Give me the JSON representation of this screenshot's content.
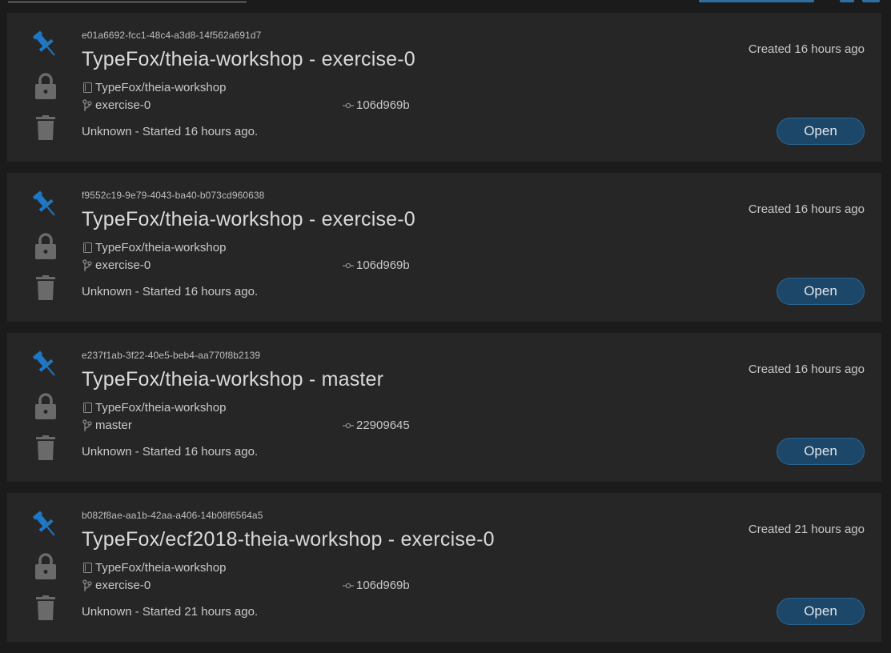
{
  "colors": {
    "background": "#1b1b1b",
    "card": "#262626",
    "pin": "#1e78c6",
    "icon_muted": "#6a6a6a",
    "open_button": "#1c4769"
  },
  "icons": {
    "pin": "pin-icon",
    "lock": "lock-icon",
    "trash": "trash-icon",
    "repo": "repo-icon",
    "branch": "branch-icon",
    "commit": "commit-icon"
  },
  "workspaces": [
    {
      "id": "e01a6692-fcc1-48c4-a3d8-14f562a691d7",
      "title": "TypeFox/theia-workshop - exercise-0",
      "repo": "TypeFox/theia-workshop",
      "branch": "exercise-0",
      "commit": "106d969b",
      "status": "Unknown - Started 16 hours ago.",
      "created": "Created 16 hours ago",
      "open_label": "Open"
    },
    {
      "id": "f9552c19-9e79-4043-ba40-b073cd960638",
      "title": "TypeFox/theia-workshop - exercise-0",
      "repo": "TypeFox/theia-workshop",
      "branch": "exercise-0",
      "commit": "106d969b",
      "status": "Unknown - Started 16 hours ago.",
      "created": "Created 16 hours ago",
      "open_label": "Open"
    },
    {
      "id": "e237f1ab-3f22-40e5-beb4-aa770f8b2139",
      "title": "TypeFox/theia-workshop - master",
      "repo": "TypeFox/theia-workshop",
      "branch": "master",
      "commit": "22909645",
      "status": "Unknown - Started 16 hours ago.",
      "created": "Created 16 hours ago",
      "open_label": "Open"
    },
    {
      "id": "b082f8ae-aa1b-42aa-a406-14b08f6564a5",
      "title": "TypeFox/ecf2018-theia-workshop - exercise-0",
      "repo": "TypeFox/theia-workshop",
      "branch": "exercise-0",
      "commit": "106d969b",
      "status": "Unknown - Started 21 hours ago.",
      "created": "Created 21 hours ago",
      "open_label": "Open"
    }
  ]
}
